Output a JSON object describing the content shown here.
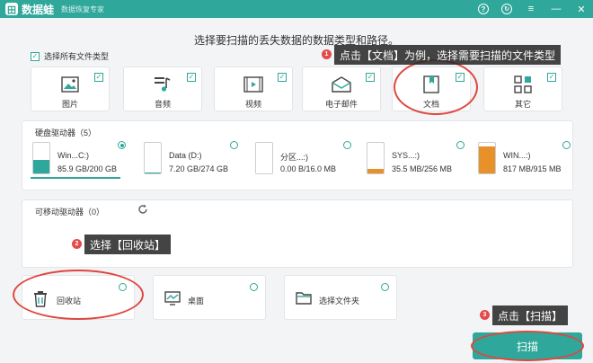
{
  "titlebar": {
    "app_name": "数据蛙",
    "app_sub": "数据恢复专家",
    "logo_glyph": "田",
    "help_glyph": "?",
    "register_glyph": "↻",
    "menu_glyph": "≡",
    "minimize_glyph": "—",
    "close_glyph": "✕"
  },
  "heading": "选择要扫描的丢失数据的数据类型和路径。",
  "select_all": {
    "label": "选择所有文件类型",
    "checked": true
  },
  "file_types": [
    {
      "label": "图片",
      "icon": "image-icon",
      "checked": true
    },
    {
      "label": "音频",
      "icon": "music-icon",
      "checked": true
    },
    {
      "label": "视频",
      "icon": "video-icon",
      "checked": true
    },
    {
      "label": "电子邮件",
      "icon": "email-icon",
      "checked": true
    },
    {
      "label": "文档",
      "icon": "document-icon",
      "checked": true
    },
    {
      "label": "其它",
      "icon": "others-icon",
      "checked": true
    }
  ],
  "hard_drives": {
    "title": "硬盘驱动器（5）",
    "items": [
      {
        "name": "Win...C:)",
        "size": "85.9 GB/200 GB",
        "fill": 0.43,
        "color": "#2fa79a",
        "selected": true
      },
      {
        "name": "Data (D:)",
        "size": "7.20 GB/274 GB",
        "fill": 0.03,
        "color": "#2fa79a",
        "selected": false
      },
      {
        "name": "分区...:)",
        "size": "0.00  B/16.0 MB",
        "fill": 0.0,
        "color": "#e8902a",
        "selected": false
      },
      {
        "name": "SYS...:)",
        "size": "35.5 MB/256 MB",
        "fill": 0.14,
        "color": "#e8902a",
        "selected": false
      },
      {
        "name": "WIN...:)",
        "size": "817 MB/915 MB",
        "fill": 0.89,
        "color": "#e8902a",
        "selected": false
      }
    ]
  },
  "removable": {
    "title": "可移动驱动器（0）",
    "refresh_icon": "refresh-icon"
  },
  "locations": [
    {
      "label": "回收站",
      "icon": "recycle-bin-icon"
    },
    {
      "label": "桌面",
      "icon": "desktop-icon"
    },
    {
      "label": "选择文件夹",
      "icon": "folder-icon"
    }
  ],
  "scan_button": "扫描",
  "tips": [
    {
      "num": "1",
      "text": "点击【文档】为例，选择需要扫描的文件类型"
    },
    {
      "num": "2",
      "text": "选择【回收站】"
    },
    {
      "num": "3",
      "text": "点击【扫描】"
    }
  ],
  "colors": {
    "accent": "#2fa79a",
    "warning": "#e8902a",
    "annotation": "#e0463f"
  }
}
